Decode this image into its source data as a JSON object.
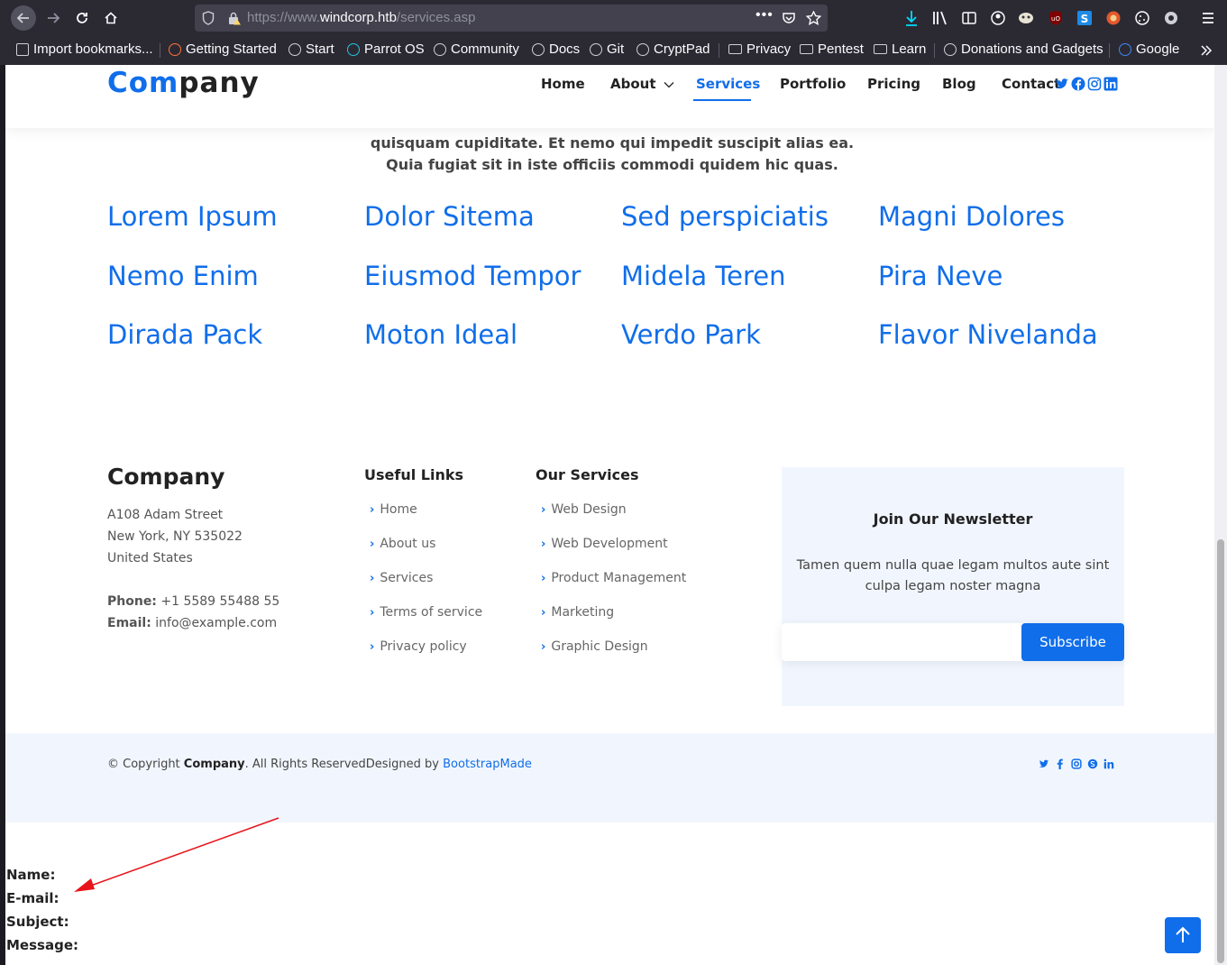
{
  "browser": {
    "url_scheme": "https://www.",
    "url_host": "windcorp.htb",
    "url_path": "/services.asp",
    "bookmarks": [
      {
        "label": "Import bookmarks...",
        "icon": "import-icon"
      },
      {
        "label": "Getting Started",
        "icon": "firefox-icon"
      },
      {
        "label": "Start",
        "icon": "globe-icon"
      },
      {
        "label": "Parrot OS",
        "icon": "parrot-icon"
      },
      {
        "label": "Community",
        "icon": "globe-icon"
      },
      {
        "label": "Docs",
        "icon": "globe-icon"
      },
      {
        "label": "Git",
        "icon": "globe-icon"
      },
      {
        "label": "CryptPad",
        "icon": "globe-icon"
      },
      {
        "label": "Privacy",
        "icon": "folder-icon"
      },
      {
        "label": "Pentest",
        "icon": "folder-icon"
      },
      {
        "label": "Learn",
        "icon": "folder-icon"
      },
      {
        "label": "Donations and Gadgets",
        "icon": "globe-icon"
      },
      {
        "label": "Google",
        "icon": "google-icon"
      }
    ]
  },
  "header": {
    "logo_part1": "Com",
    "logo_part2": "pany",
    "menu": [
      "Home",
      "About",
      "Services",
      "Portfolio",
      "Pricing",
      "Blog",
      "Contact"
    ],
    "active_menu": "Services"
  },
  "intro": {
    "text": "quisquam cupiditate. Et nemo qui impedit suscipit alias ea. Quia fugiat sit in iste officiis commodi quidem hic quas."
  },
  "services_grid": [
    [
      "Lorem Ipsum",
      "Dolor Sitema",
      "Sed perspiciatis",
      "Magni Dolores"
    ],
    [
      "Nemo Enim",
      "Eiusmod Tempor",
      "Midela Teren",
      "Pira Neve"
    ],
    [
      "Dirada Pack",
      "Moton Ideal",
      "Verdo Park",
      "Flavor Nivelanda"
    ]
  ],
  "footer": {
    "company": "Company",
    "address": [
      "A108 Adam Street",
      "New York, NY 535022",
      "United States"
    ],
    "phone_label": "Phone:",
    "phone": "+1 5589 55488 55",
    "email_label": "Email:",
    "email": "info@example.com",
    "useful_links_title": "Useful Links",
    "useful_links": [
      "Home",
      "About us",
      "Services",
      "Terms of service",
      "Privacy policy"
    ],
    "services_title": "Our Services",
    "services": [
      "Web Design",
      "Web Development",
      "Product Management",
      "Marketing",
      "Graphic Design"
    ],
    "newsletter_title": "Join Our Newsletter",
    "newsletter_text": "Tamen quem nulla quae legam multos aute sint culpa legam noster magna",
    "subscribe_label": "Subscribe",
    "copyright_prefix": "© Copyright ",
    "copyright_company": "Company",
    "copyright_suffix": ". All Rights ReservedDesigned by ",
    "designer": "BootstrapMade"
  },
  "contact_form_labels": [
    "Name:",
    "E-mail:",
    "Subject:",
    "Message:"
  ],
  "colors": {
    "accent": "#106eea",
    "annotation_arrow": "#e8141a",
    "browser_chrome": "#2b2a33"
  }
}
